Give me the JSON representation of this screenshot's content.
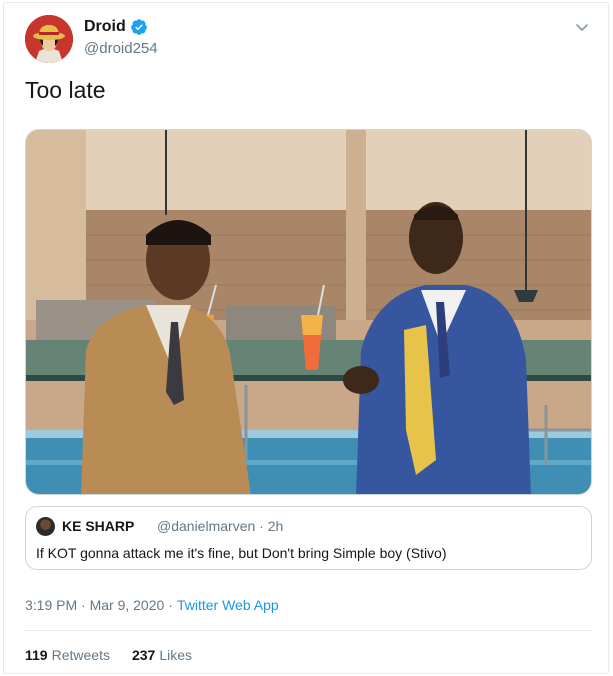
{
  "author": {
    "display_name": "Droid",
    "handle": "@droid254",
    "verified": true,
    "avatar_icon": "straw-hat-avatar"
  },
  "tweet": {
    "text": "Too late"
  },
  "quoted_tweet": {
    "name": "KE SHARP",
    "meta": "@danielmarven · 2h",
    "text": "If KOT gonna attack me it's fine, but Don't bring Simple boy (Stivo)"
  },
  "timestamp": {
    "time_date": "3:19 PM · Mar 9, 2020",
    "separator": "·",
    "source": "Twitter Web App"
  },
  "stats": {
    "retweets_count": "119",
    "retweets_label": "Retweets",
    "likes_count": "237",
    "likes_label": "Likes"
  },
  "colors": {
    "verified_blue": "#1da1f2",
    "secondary_text": "#657786",
    "border": "#e6ecf0"
  }
}
